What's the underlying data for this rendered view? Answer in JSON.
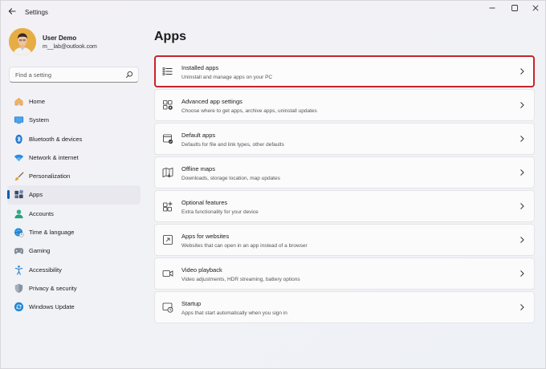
{
  "window": {
    "title": "Settings",
    "icons": {
      "back": "back-arrow-icon",
      "minimize": "minimize-icon",
      "maximize": "maximize-icon",
      "close": "close-icon"
    }
  },
  "profile": {
    "name": "User Demo",
    "email": "m__lab@outlook.com"
  },
  "search": {
    "placeholder": "Find a setting"
  },
  "sidebar": {
    "items": [
      {
        "label": "Home",
        "icon": "home-icon"
      },
      {
        "label": "System",
        "icon": "system-icon"
      },
      {
        "label": "Bluetooth & devices",
        "icon": "bluetooth-icon"
      },
      {
        "label": "Network & internet",
        "icon": "wifi-icon"
      },
      {
        "label": "Personalization",
        "icon": "brush-icon"
      },
      {
        "label": "Apps",
        "icon": "apps-icon",
        "active": true
      },
      {
        "label": "Accounts",
        "icon": "accounts-icon"
      },
      {
        "label": "Time & language",
        "icon": "globe-clock-icon"
      },
      {
        "label": "Gaming",
        "icon": "gamepad-icon"
      },
      {
        "label": "Accessibility",
        "icon": "accessibility-icon"
      },
      {
        "label": "Privacy & security",
        "icon": "shield-icon"
      },
      {
        "label": "Windows Update",
        "icon": "update-icon"
      }
    ]
  },
  "main": {
    "title": "Apps",
    "cards": [
      {
        "title": "Installed apps",
        "desc": "Uninstall and manage apps on your PC",
        "icon": "list-icon",
        "highlighted": true
      },
      {
        "title": "Advanced app settings",
        "desc": "Choose where to get apps, archive apps, uninstall updates",
        "icon": "app-settings-icon"
      },
      {
        "title": "Default apps",
        "desc": "Defaults for file and link types, other defaults",
        "icon": "default-apps-icon"
      },
      {
        "title": "Offline maps",
        "desc": "Downloads, storage location, map updates",
        "icon": "map-icon"
      },
      {
        "title": "Optional features",
        "desc": "Extra functionality for your device",
        "icon": "add-features-icon"
      },
      {
        "title": "Apps for websites",
        "desc": "Websites that can open in an app instead of a browser",
        "icon": "web-app-icon"
      },
      {
        "title": "Video playback",
        "desc": "Video adjustments, HDR streaming, battery options",
        "icon": "video-icon"
      },
      {
        "title": "Startup",
        "desc": "Apps that start automatically when you sign in",
        "icon": "startup-icon"
      }
    ]
  },
  "colors": {
    "accent": "#005fb8",
    "highlight_border": "#c8242b"
  }
}
